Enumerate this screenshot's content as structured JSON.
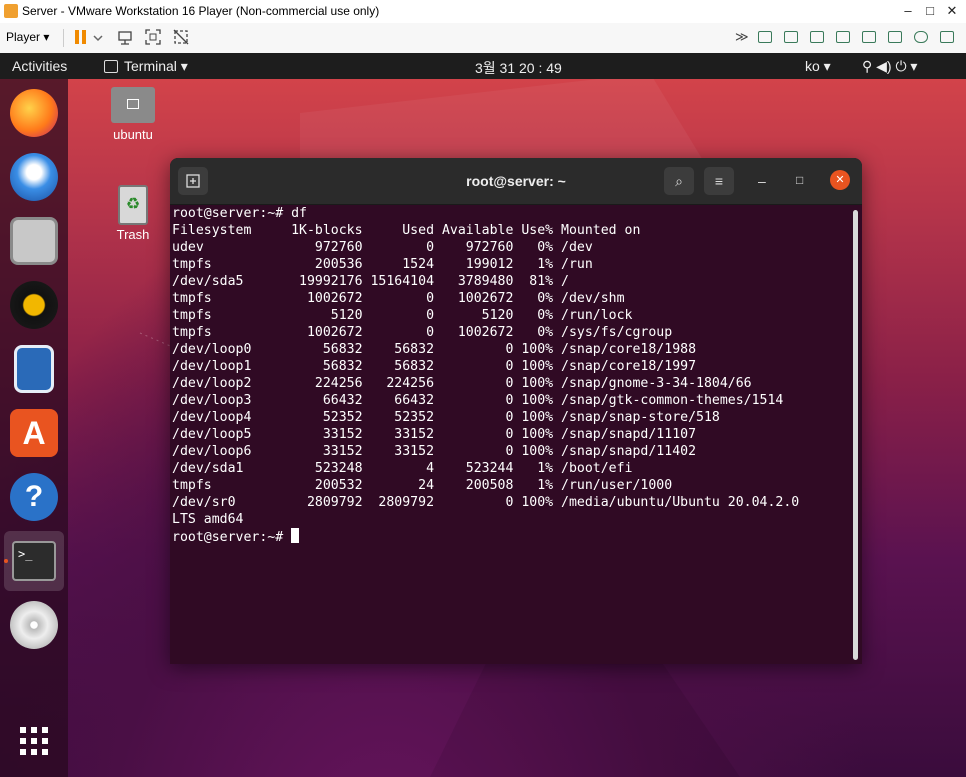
{
  "window": {
    "title": "Server - VMware Workstation 16 Player (Non-commercial use only)",
    "minimize": "–",
    "maximize": "□",
    "close": "✕"
  },
  "player_toolbar": {
    "player_menu": "Player ▾",
    "pause_icon": "pause-icon",
    "accent": "#f08a00"
  },
  "gnome": {
    "activities": "Activities",
    "app_menu": "Terminal ▾",
    "clock": "3월 31  20 : 49",
    "input_method": "ko ▾",
    "system_icons": "⚲  ◀)  ⏻  ▾"
  },
  "desktop": {
    "home_label": "ubuntu",
    "trash_label": "Trash"
  },
  "terminal": {
    "title": "root@server: ~",
    "new_tab_icon": "new-tab-icon",
    "search_icon": "⌕",
    "menu_icon": "≡",
    "minimize": "–",
    "maximize": "□",
    "close": "✕",
    "prompt": "root@server:~# df",
    "header": "Filesystem     1K-blocks     Used Available Use% Mounted on",
    "rows": [
      "udev              972760        0    972760   0% /dev",
      "tmpfs             200536     1524    199012   1% /run",
      "/dev/sda5       19992176 15164104   3789480  81% /",
      "tmpfs            1002672        0   1002672   0% /dev/shm",
      "tmpfs               5120        0      5120   0% /run/lock",
      "tmpfs            1002672        0   1002672   0% /sys/fs/cgroup",
      "/dev/loop0         56832    56832         0 100% /snap/core18/1988",
      "/dev/loop1         56832    56832         0 100% /snap/core18/1997",
      "/dev/loop2        224256   224256         0 100% /snap/gnome-3-34-1804/66",
      "/dev/loop3         66432    66432         0 100% /snap/gtk-common-themes/1514",
      "/dev/loop4         52352    52352         0 100% /snap/snap-store/518",
      "/dev/loop5         33152    33152         0 100% /snap/snapd/11107",
      "/dev/loop6         33152    33152         0 100% /snap/snapd/11402",
      "/dev/sda1         523248        4    523244   1% /boot/efi",
      "tmpfs             200532       24    200508   1% /run/user/1000",
      "/dev/sr0         2809792  2809792         0 100% /media/ubuntu/Ubuntu 20.04.2.0",
      "LTS amd64"
    ],
    "final_prompt": "root@server:~# "
  }
}
